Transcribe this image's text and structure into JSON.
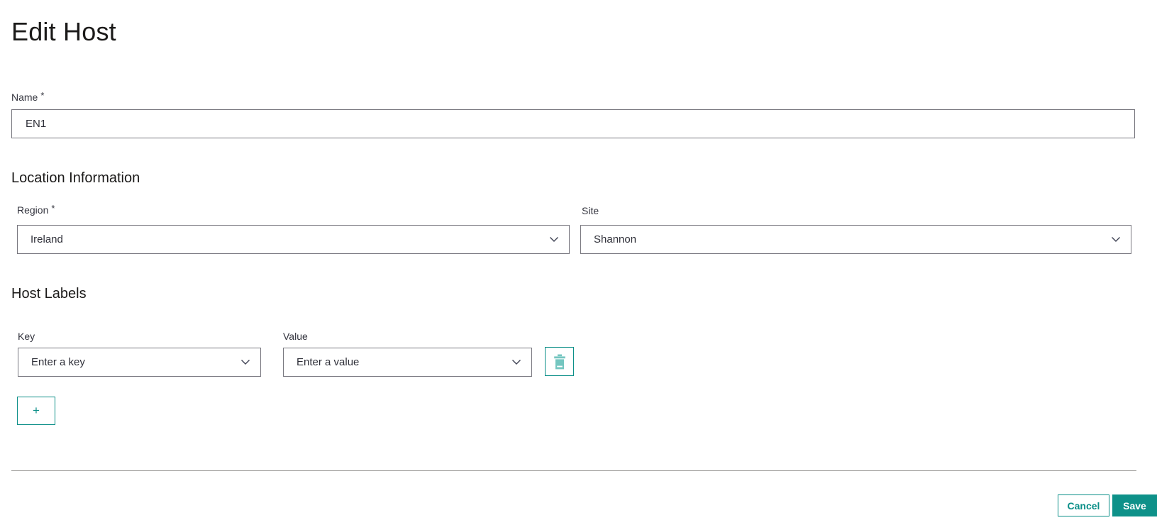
{
  "window": {
    "title": "Edit Host"
  },
  "colors": {
    "accent_teal": "#0b8f88",
    "save_button_teal": "#0e9189",
    "trash_icon_teal": "#74c6c0",
    "input_border_gray": "#77767e",
    "divider_gray": "#9b9a98",
    "text_dark": "#2e2f38"
  },
  "form": {
    "name": {
      "label": "Name",
      "required_marker": "*",
      "value": "EN1"
    },
    "location": {
      "heading": "Location Information",
      "region": {
        "label": "Region",
        "required_marker": "*",
        "selected": "Ireland"
      },
      "site": {
        "label": "Site",
        "selected": "Shannon"
      }
    },
    "host_labels": {
      "heading": "Host Labels",
      "key": {
        "label": "Key",
        "placeholder": "Enter a key"
      },
      "value": {
        "label": "Value",
        "placeholder": "Enter a value"
      },
      "add_label": "+"
    }
  },
  "footer": {
    "cancel": "Cancel",
    "save": "Save"
  }
}
